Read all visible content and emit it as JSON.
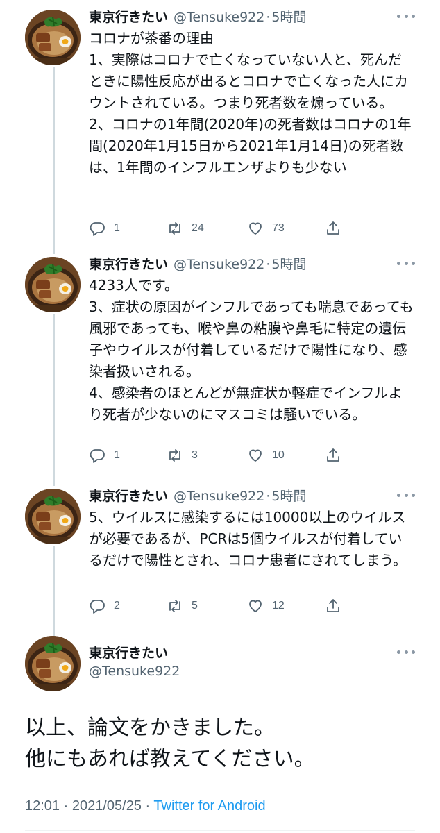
{
  "author": {
    "name": "東京行きたい",
    "handle": "@Tensuke922"
  },
  "tweets": [
    {
      "time": "5時間",
      "text": "コロナが茶番の理由\n1、実際はコロナで亡くなっていない人と、死んだときに陽性反応が出るとコロナで亡くなった人にカウントされている。つまり死者数を煽っている。\n2、コロナの1年間(2020年)の死者数はコロナの1年間(2020年1月15日から2021年1月14日)の死者数は、1年間のインフルエンザよりも少ない",
      "replies": "1",
      "retweets": "24",
      "likes": "73"
    },
    {
      "time": "5時間",
      "text": "4233人です。\n3、症状の原因がインフルであっても喘息であっても風邪であっても、喉や鼻の粘膜や鼻毛に特定の遺伝子やウイルスが付着しているだけで陽性になり、感染者扱いされる。\n4、感染者のほとんどが無症状か軽症でインフルより死者が少ないのにマスコミは騒いでいる。",
      "replies": "1",
      "retweets": "3",
      "likes": "10"
    },
    {
      "time": "5時間",
      "text": "5、ウイルスに感染するには10000以上のウイルスが必要であるが、PCRは5個ウイルスが付着しているだけで陽性とされ、コロナ患者にされてしまう。",
      "replies": "2",
      "retweets": "5",
      "likes": "12"
    }
  ],
  "main_tweet": {
    "text": "以上、論文をかきました。\n他にもあれば教えてください。",
    "time": "12:01",
    "date": "2021/05/25",
    "source": "Twitter for Android"
  },
  "separator": "·",
  "icons": {
    "reply": "reply-icon",
    "retweet": "retweet-icon",
    "like": "heart-icon",
    "share": "share-icon",
    "more": "more-icon"
  },
  "colors": {
    "text": "#0f1419",
    "muted": "#536471",
    "link": "#1d9bf0",
    "thread": "#cfd9de"
  }
}
